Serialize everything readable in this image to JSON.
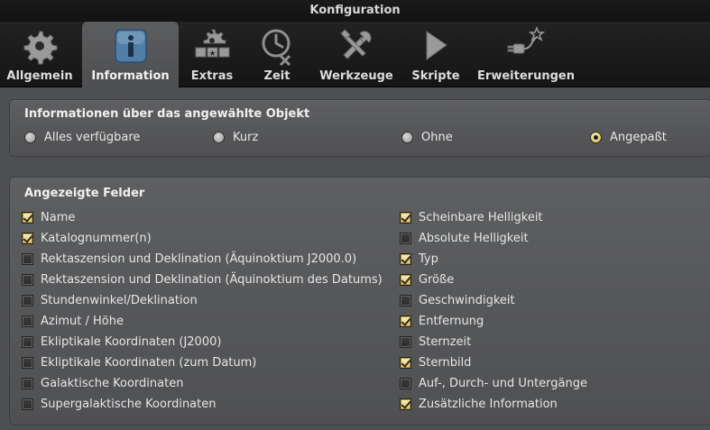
{
  "window": {
    "title": "Konfiguration"
  },
  "tabs": [
    {
      "label": "Allgemein",
      "icon": "gear-icon"
    },
    {
      "label": "Information",
      "icon": "info-icon",
      "active": true
    },
    {
      "label": "Extras",
      "icon": "extras-icon"
    },
    {
      "label": "Zeit",
      "icon": "clock-icon"
    },
    {
      "label": "Werkzeuge",
      "icon": "tools-icon"
    },
    {
      "label": "Skripte",
      "icon": "play-icon"
    },
    {
      "label": "Erweiterungen",
      "icon": "plugin-icon"
    }
  ],
  "info_panel": {
    "title": "Informationen über das angewählte Objekt",
    "options": [
      {
        "label": "Alles verfügbare",
        "selected": false
      },
      {
        "label": "Kurz",
        "selected": false
      },
      {
        "label": "Ohne",
        "selected": false
      },
      {
        "label": "Angepaßt",
        "selected": true
      }
    ]
  },
  "fields_panel": {
    "title": "Angezeigte Felder",
    "left": [
      {
        "label": "Name",
        "checked": true
      },
      {
        "label": "Katalognummer(n)",
        "checked": true
      },
      {
        "label": "Rektaszension und Deklination (Äquinoktium J2000.0)",
        "checked": false
      },
      {
        "label": "Rektaszension und Deklination (Äquinoktium des Datums)",
        "checked": false
      },
      {
        "label": "Stundenwinkel/Deklination",
        "checked": false
      },
      {
        "label": "Azimut / Höhe",
        "checked": false
      },
      {
        "label": "Ekliptikale Koordinaten (J2000)",
        "checked": false
      },
      {
        "label": "Ekliptikale Koordinaten (zum Datum)",
        "checked": false
      },
      {
        "label": "Galaktische Koordinaten",
        "checked": false
      },
      {
        "label": "Supergalaktische Koordinaten",
        "checked": false
      }
    ],
    "right": [
      {
        "label": "Scheinbare Helligkeit",
        "checked": true
      },
      {
        "label": "Absolute Helligkeit",
        "checked": false
      },
      {
        "label": "Typ",
        "checked": true
      },
      {
        "label": "Größe",
        "checked": true
      },
      {
        "label": "Geschwindigkeit",
        "checked": false
      },
      {
        "label": "Entfernung",
        "checked": true
      },
      {
        "label": "Sternzeit",
        "checked": false
      },
      {
        "label": "Sternbild",
        "checked": true
      },
      {
        "label": "Auf-, Durch- und Untergänge",
        "checked": false
      },
      {
        "label": "Zusätzliche Information",
        "checked": true
      }
    ]
  }
}
